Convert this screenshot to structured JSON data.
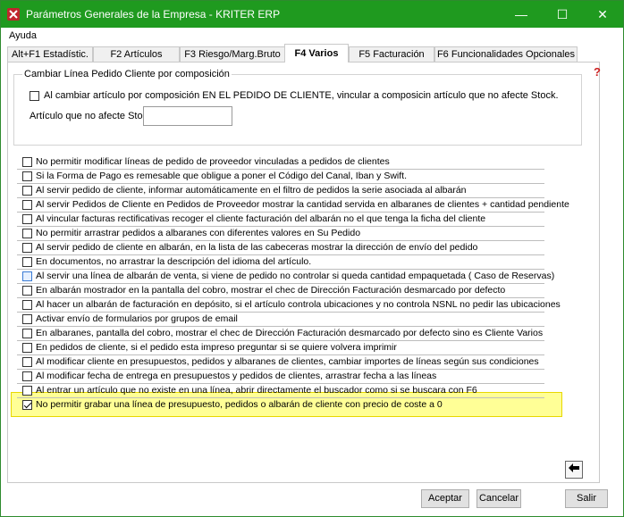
{
  "window": {
    "title": "Parámetros Generales de la Empresa - KRITER ERP",
    "minimize": "—",
    "maximize": "☐",
    "close": "✕"
  },
  "menu": {
    "ayuda": "Ayuda"
  },
  "tabs": [
    {
      "label": "Alt+F1 Estadístic."
    },
    {
      "label": "F2 Artículos"
    },
    {
      "label": "F3 Riesgo/Marg.Bruto"
    },
    {
      "label": "F4 Varios",
      "active": true
    },
    {
      "label": "F5 Facturación"
    },
    {
      "label": "F6 Funcionalidades Opcionales"
    }
  ],
  "group": {
    "title": "Cambiar Línea Pedido Cliente por composición",
    "checkbox_label": "Al cambiar  artículo por composición EN EL PEDIDO DE CLIENTE, vincular a composicin artículo que no afecte Stock.",
    "field_label": "Artículo que no afecte Stock.",
    "field_value": ""
  },
  "options": [
    {
      "label": "No permitir modificar líneas de pedido de proveedor vinculadas a pedidos de clientes",
      "checked": false
    },
    {
      "label": "Si la Forma de Pago es remesable que obligue a poner el Código del Canal, Iban y Swift.",
      "checked": false
    },
    {
      "label": "Al servir pedido de cliente, informar automáticamente en el filtro de pedidos la serie asociada al albarán",
      "checked": false
    },
    {
      "label": "Al servir Pedidos de Cliente en Pedidos de Proveedor mostrar la cantidad servida en albaranes de clientes + cantidad pendiente",
      "checked": false
    },
    {
      "label": "Al vincular facturas rectificativas recoger el cliente facturación del albarán no el que tenga la ficha del cliente",
      "checked": false
    },
    {
      "label": "No permitir arrastrar pedidos a albaranes con diferentes valores en Su Pedido",
      "checked": false
    },
    {
      "label": "Al servir pedido de cliente en albarán, en la lista de las cabeceras mostrar la dirección de envío del pedido",
      "checked": false
    },
    {
      "label": "En documentos, no arrastrar la descripción del idioma del artículo.",
      "checked": false
    },
    {
      "label": "Al servir una línea de albarán de venta, si viene de pedido no controlar si queda cantidad empaquetada ( Caso de Reservas)",
      "checked": false,
      "focused": true
    },
    {
      "label": "En albarán mostrador en la pantalla del cobro, mostrar el chec de Dirección Facturación desmarcado por defecto",
      "checked": false
    },
    {
      "label": "Al hacer un albarán de facturación en depósito, si el artículo controla ubicaciones y no controla NSNL no pedir las ubicaciones",
      "checked": false
    },
    {
      "label": "Activar envío de formularios por grupos de email",
      "checked": false
    },
    {
      "label": "En albaranes, pantalla del cobro, mostrar el chec de Dirección Facturación desmarcado por defecto sino es Cliente Varios",
      "checked": false
    },
    {
      "label": "En pedidos de cliente, si el pedido esta impreso preguntar si se quiere volvera  imprimir",
      "checked": false
    },
    {
      "label": "Al modificar cliente en presupuestos, pedidos y albaranes de clientes, cambiar importes de líneas según sus condiciones",
      "checked": false
    },
    {
      "label": "Al modificar fecha de entrega en presupuestos y pedidos de clientes, arrastrar fecha a las líneas",
      "checked": false
    },
    {
      "label": "Al entrar un artículo que no existe en una línea, abrir directamente el buscador como si se buscara con F6",
      "checked": false
    },
    {
      "label": "No permitir grabar una línea de presupuesto, pedidos o albarán de cliente con precio de coste a 0",
      "checked": true
    }
  ],
  "buttons": {
    "accept": "Aceptar",
    "cancel": "Cancelar",
    "exit": "Salir"
  },
  "colors": {
    "titlebar": "#1f9a1f",
    "highlight": "#ffff96",
    "highlight_border": "#e8d800"
  }
}
